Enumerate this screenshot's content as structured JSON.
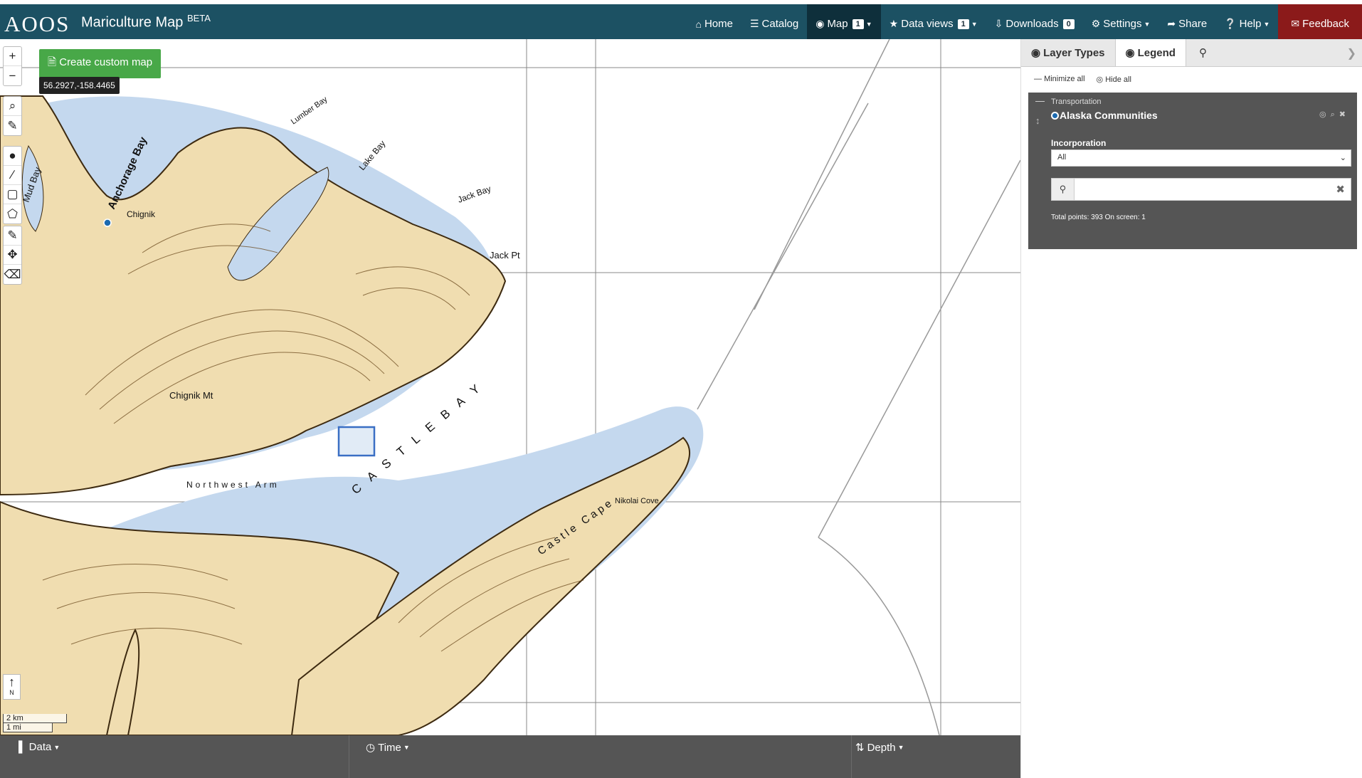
{
  "app": {
    "logo": "AOOS",
    "title": "Mariculture Map",
    "title_sup": "BETA"
  },
  "nav": {
    "home": "Home",
    "catalog": "Catalog",
    "map": "Map",
    "map_badge": "1",
    "data_views": "Data views",
    "data_views_badge": "1",
    "downloads": "Downloads",
    "downloads_badge": "0",
    "settings": "Settings",
    "share": "Share",
    "help": "Help",
    "feedback": "Feedback"
  },
  "map": {
    "create_custom_map": "Create custom map",
    "coordinates": "56.2927,-158.4465",
    "north_label": "N",
    "scale_km": "2 km",
    "scale_mi": "1 mi",
    "place_names": {
      "mud_bay": "Mud Bay",
      "anchorage_bay": "Anchorage Bay",
      "chignik": "Chignik",
      "lake_bay": "Lake Bay",
      "lumber_bay": "Lumber Bay",
      "jack_bay": "Jack Bay",
      "jack_pt": "Jack Pt",
      "chignik_mt": "Chignik Mt",
      "castle_bay": "C A S T L E   B A Y",
      "northwest_arm": "Northwest Arm",
      "castle_cape": "Castle Cape",
      "nikolai_cove": "Nikolai Cove"
    }
  },
  "bottom": {
    "data": "Data",
    "time": "Time",
    "depth": "Depth"
  },
  "panel": {
    "tab_layer_types": "Layer Types",
    "tab_legend": "Legend",
    "minimize_all": "Minimize all",
    "hide_all": "Hide all",
    "layer": {
      "category": "Transportation",
      "name": "Alaska Communities",
      "filter_label": "Incorporation",
      "filter_value": "All",
      "total": "Total points: 393 On screen: 1"
    }
  },
  "colors": {
    "navbar": "#1c5163",
    "feedback": "#8b1a1a",
    "land": "#f0ddb0",
    "shallow_water": "#c4d8ee",
    "contour": "#6b4a1e",
    "layer_box": "#555555",
    "custom_map_button": "#48a848"
  }
}
